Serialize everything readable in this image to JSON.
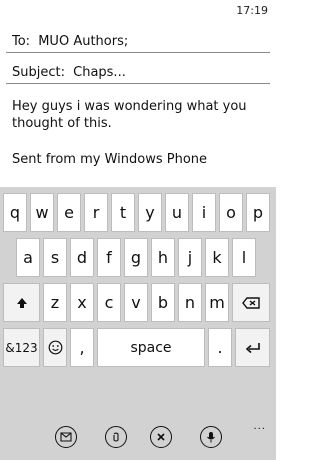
{
  "status": {
    "time": "17:19"
  },
  "compose": {
    "to_label": "To:",
    "to_value": "MUO Authors;",
    "subject_label": "Subject:",
    "subject_value": "Chaps...",
    "body": "Hey guys i was wondering what you thought of this.",
    "signature": "Sent from my Windows Phone"
  },
  "keyboard": {
    "row1": [
      "q",
      "w",
      "e",
      "r",
      "t",
      "y",
      "u",
      "i",
      "o",
      "p"
    ],
    "row2": [
      "a",
      "s",
      "d",
      "f",
      "g",
      "h",
      "j",
      "k",
      "l"
    ],
    "row3": [
      "z",
      "x",
      "c",
      "v",
      "b",
      "n",
      "m"
    ],
    "shift_icon": "shift-arrow-icon",
    "backspace_icon": "backspace-icon",
    "symbols_label": "&123",
    "emoji_icon": "smiley-icon",
    "comma_label": ",",
    "space_label": "space",
    "period_label": ".",
    "enter_icon": "enter-icon"
  },
  "app_bar": {
    "buttons": [
      "send-icon",
      "attach-icon",
      "delete-icon",
      "microphone-icon"
    ],
    "more_label": "..."
  }
}
